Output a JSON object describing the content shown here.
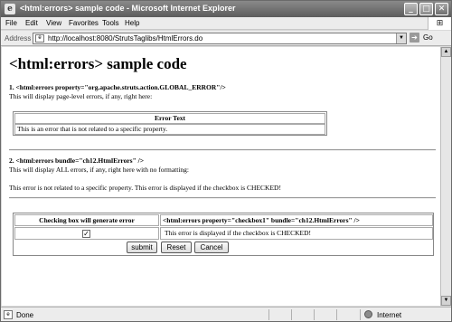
{
  "window": {
    "title": "<html:errors> sample code - Microsoft Internet Explorer",
    "app_icon": "ie-page-icon",
    "controls": {
      "minimize": "_",
      "maximize": "□",
      "close": "✕"
    }
  },
  "menu": {
    "items": [
      {
        "label": "File"
      },
      {
        "label": "Edit"
      },
      {
        "label": "View"
      },
      {
        "label": "Favorites"
      },
      {
        "label": "Tools"
      },
      {
        "label": "Help"
      }
    ],
    "throbber_icon": "windows-logo-icon"
  },
  "address": {
    "label": "Address",
    "url": "http://localhost:8080/StrutsTaglibs/HtmlErrors.do",
    "go_label": "Go"
  },
  "page": {
    "heading": "<html:errors> sample code",
    "section1": {
      "title": "1. <html:errors property=\"org.apache.struts.action.GLOBAL_ERROR\"/>",
      "desc": "This will display page-level errors, if any, right here:",
      "table_header": "Error Text",
      "table_value": "This is an error that is not related to a specific property."
    },
    "section2": {
      "title": "2. <html:errors bundle=\"ch12.HtmlErrors\" />",
      "desc": "This will display ALL errors, if any, right here with no formatting:",
      "output": "This error is not related to a specific property. This error is displayed if the checkbox is CHECKED!"
    },
    "form": {
      "col1_header": "Checking box will generate error",
      "col2_header": "<html:errors property=\"checkbox1\" bundle=\"ch12.HtmlErrors\" />",
      "checkbox_checked": true,
      "checkbox_mark": "✓",
      "error_message": "This error is displayed if the checkbox is CHECKED!",
      "buttons": {
        "submit": "submit",
        "reset": "Reset",
        "cancel": "Cancel"
      }
    }
  },
  "status": {
    "text": "Done",
    "zone": "Internet"
  }
}
